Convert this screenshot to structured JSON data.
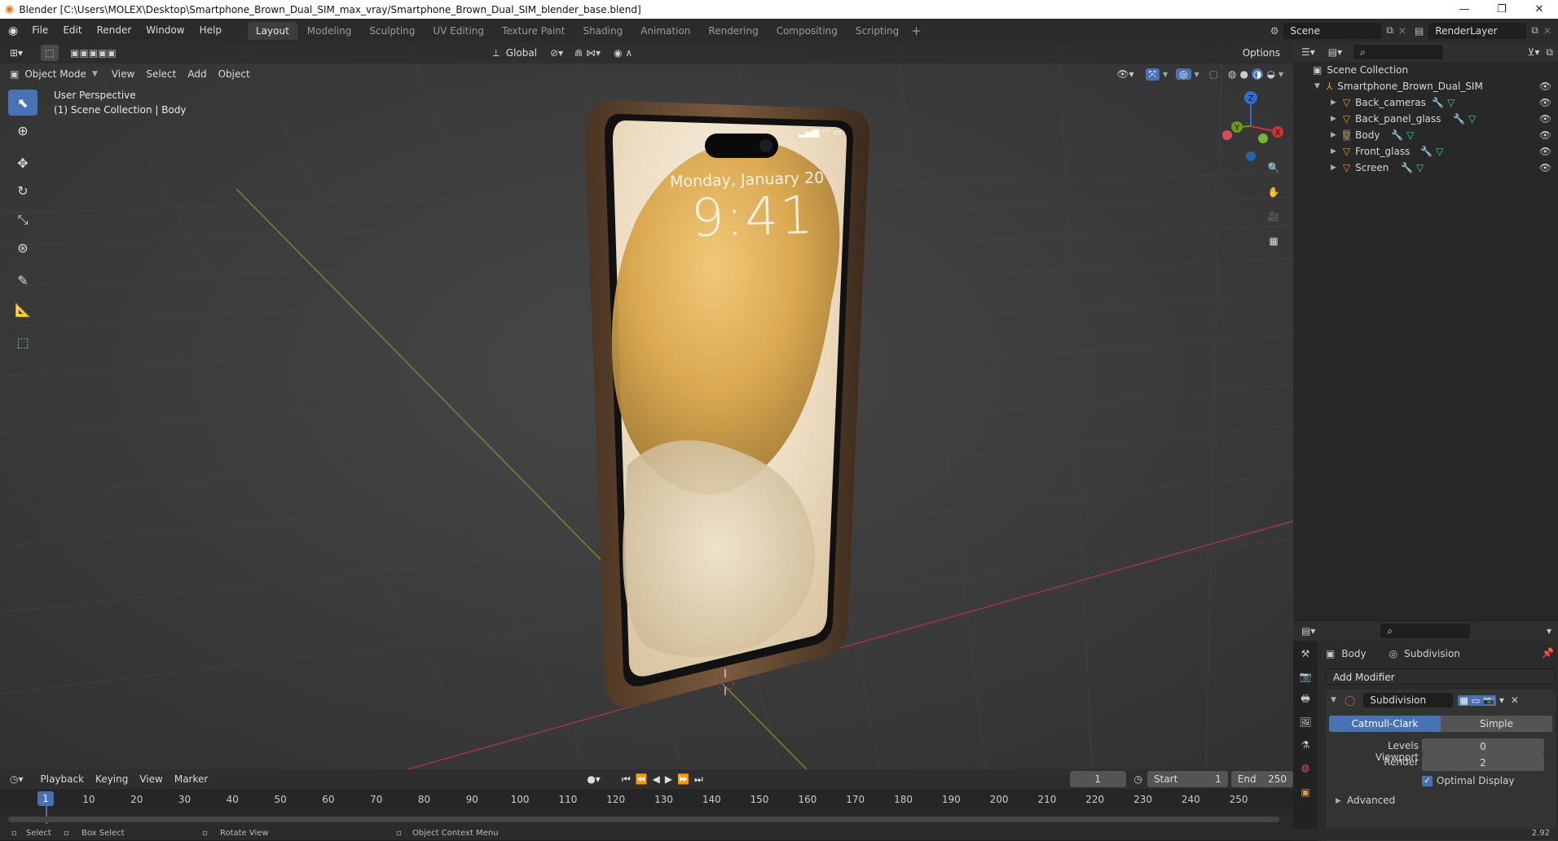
{
  "window": {
    "title": "Blender [C:\\Users\\MOLEX\\Desktop\\Smartphone_Brown_Dual_SIM_max_vray/Smartphone_Brown_Dual_SIM_blender_base.blend]"
  },
  "menubar": {
    "menus": [
      "File",
      "Edit",
      "Render",
      "Window",
      "Help"
    ],
    "workspaces": [
      "Layout",
      "Modeling",
      "Sculpting",
      "UV Editing",
      "Texture Paint",
      "Shading",
      "Animation",
      "Rendering",
      "Compositing",
      "Scripting"
    ],
    "active_workspace": "Layout",
    "scene": "Scene",
    "view_layer": "RenderLayer"
  },
  "viewport": {
    "mode": "Object Mode",
    "menus": [
      "View",
      "Select",
      "Add",
      "Object"
    ],
    "orientation": "Global",
    "options": "Options",
    "overlay_line1": "User Perspective",
    "overlay_line2": "(1) Scene Collection | Body",
    "phone_screen": {
      "date": "Monday, January 20",
      "time": "9:41"
    },
    "gizmo": {
      "z": "Z",
      "y": "Y",
      "x": "X"
    }
  },
  "outliner": {
    "root": "Scene Collection",
    "collection": "Smartphone_Brown_Dual_SIM",
    "objects": [
      {
        "name": "Back_cameras"
      },
      {
        "name": "Back_panel_glass"
      },
      {
        "name": "Body"
      },
      {
        "name": "Front_glass"
      },
      {
        "name": "Screen"
      }
    ]
  },
  "properties": {
    "object": "Body",
    "modifier_context": "Subdivision",
    "add_modifier": "Add Modifier",
    "modifier_name": "Subdivision",
    "method_catmull": "Catmull-Clark",
    "method_simple": "Simple",
    "levels_viewport_label": "Levels Viewport",
    "levels_viewport": "0",
    "render_label": "Render",
    "render": "2",
    "optimal_display": "Optimal Display",
    "advanced": "Advanced"
  },
  "timeline": {
    "menus": [
      "Playback",
      "Keying",
      "View",
      "Marker"
    ],
    "current_frame": "1",
    "start_label": "Start",
    "start": "1",
    "end_label": "End",
    "end": "250",
    "ticks": [
      "1",
      "10",
      "20",
      "30",
      "40",
      "50",
      "60",
      "70",
      "80",
      "90",
      "100",
      "110",
      "120",
      "130",
      "140",
      "150",
      "160",
      "170",
      "180",
      "190",
      "200",
      "210",
      "220",
      "230",
      "240",
      "250"
    ]
  },
  "statusbar": {
    "select": "Select",
    "box_select": "Box Select",
    "rotate_view": "Rotate View",
    "context_menu": "Object Context Menu",
    "version": "2.92"
  }
}
